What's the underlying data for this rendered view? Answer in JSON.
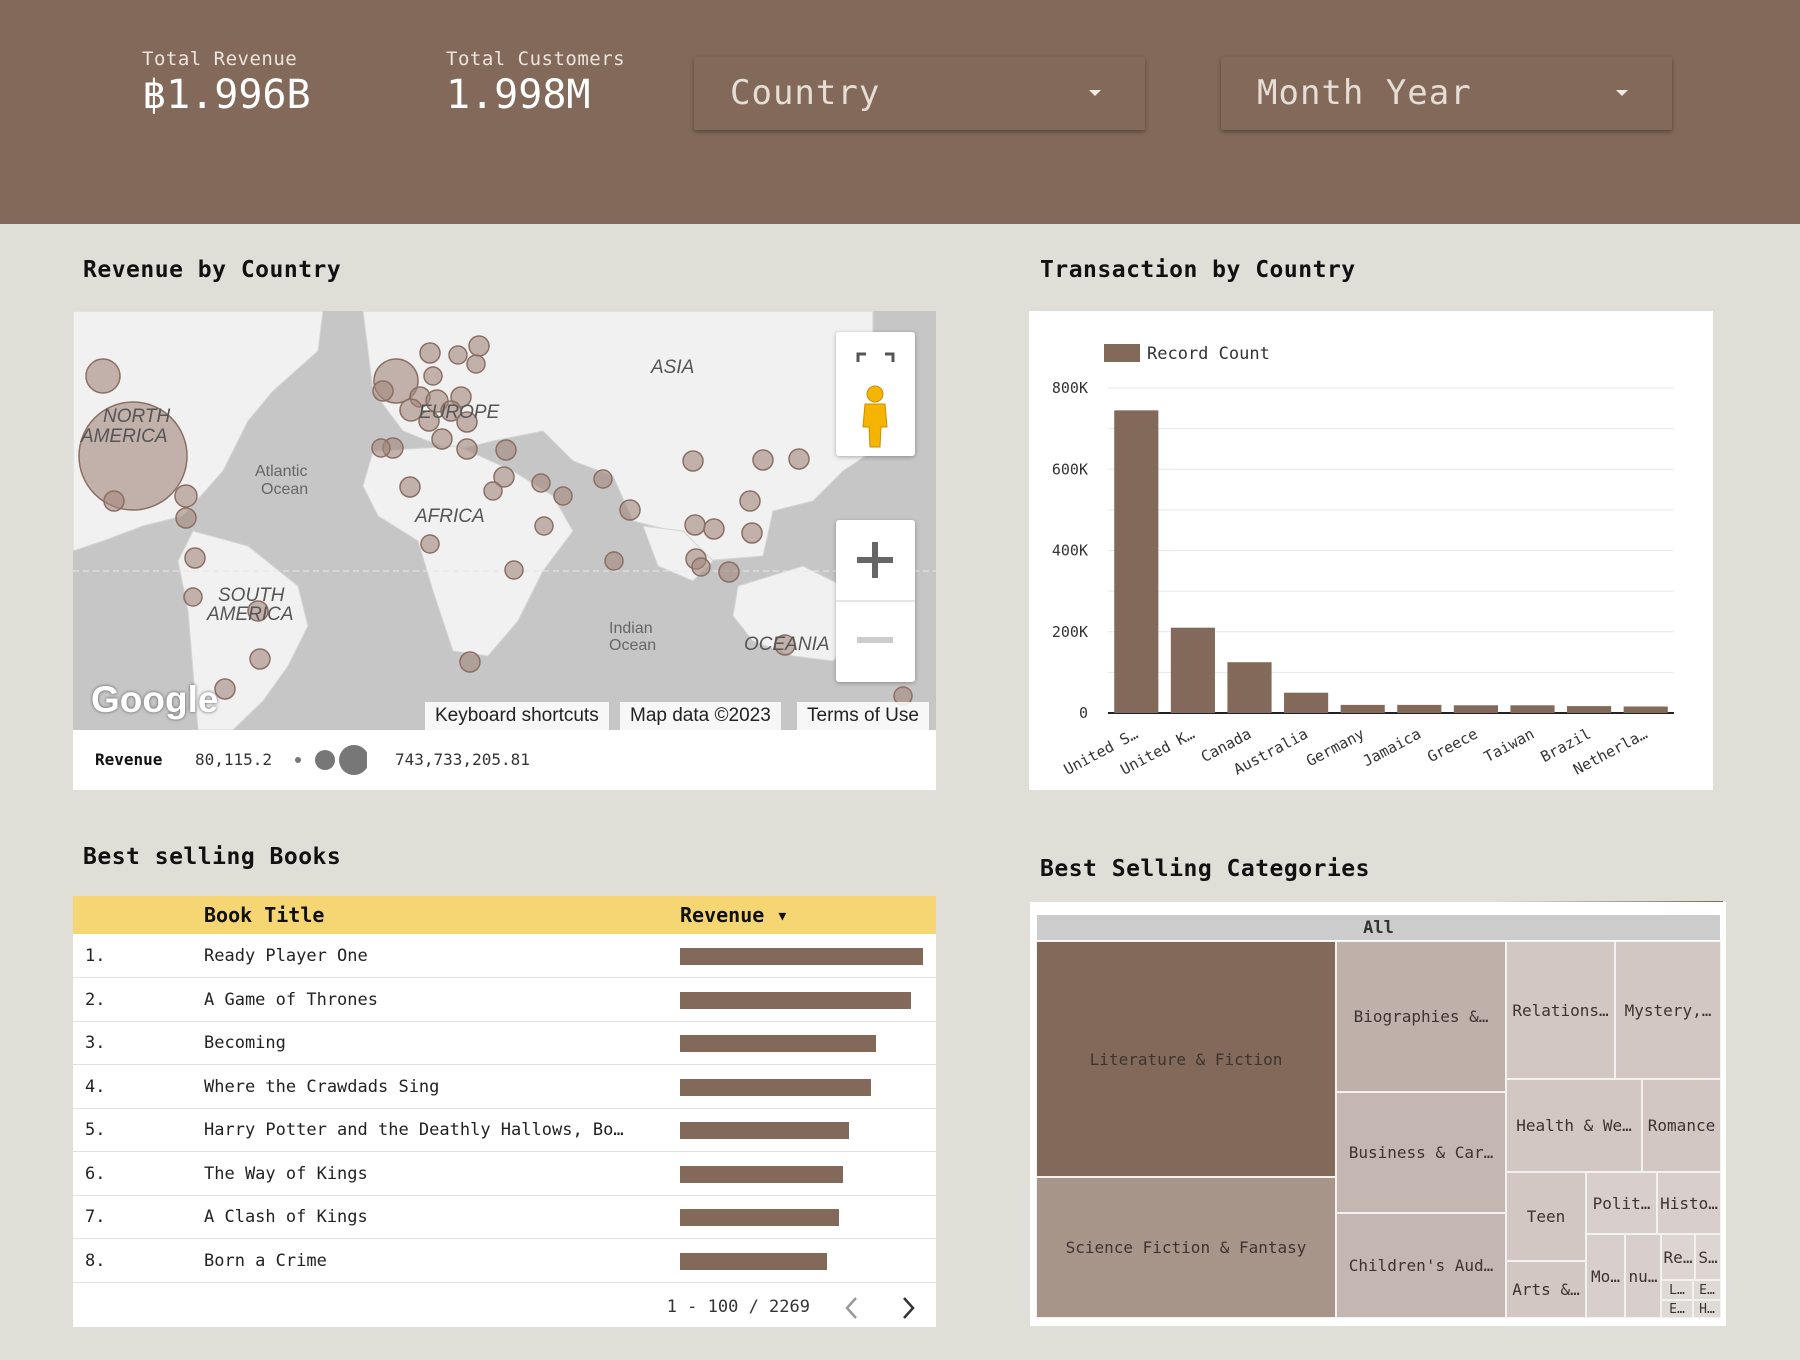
{
  "header": {
    "kpis": [
      {
        "label": "Total Revenue",
        "value": "฿1.996B"
      },
      {
        "label": "Total Customers",
        "value": "1.998M"
      }
    ],
    "filters": [
      {
        "label": "Country"
      },
      {
        "label": "Month Year"
      }
    ]
  },
  "revenue_map": {
    "title": "Revenue by Country",
    "continents": [
      "NORTH AMERICA",
      "SOUTH AMERICA",
      "EUROPE",
      "AFRICA",
      "ASIA",
      "OCEANIA"
    ],
    "oceans": [
      "Atlantic Ocean",
      "Indian Ocean"
    ],
    "attribution": {
      "logo": "Google",
      "shortcuts": "Keyboard shortcuts",
      "map_data": "Map data ©2023",
      "terms": "Terms of Use"
    },
    "legend": {
      "metric": "Revenue",
      "min": "80,115.2",
      "max": "743,733,205.81"
    }
  },
  "transaction_chart": {
    "title": "Transaction by Country",
    "chart_data": {
      "type": "bar",
      "legend": "Record Count",
      "categories": [
        "United S…",
        "United K…",
        "Canada",
        "Australia",
        "Germany",
        "Jamaica",
        "Greece",
        "Taiwan",
        "Brazil",
        "Netherla…"
      ],
      "values": [
        745000,
        210000,
        125000,
        50000,
        20000,
        20000,
        19000,
        19000,
        17000,
        16000
      ],
      "yticks": [
        "0",
        "200K",
        "400K",
        "600K",
        "800K"
      ],
      "ylim": [
        0,
        800000
      ],
      "color": "#836959"
    }
  },
  "books_table": {
    "title": "Best selling Books",
    "columns": {
      "title": "Book Title",
      "revenue": "Revenue ▾"
    },
    "rows": [
      {
        "n": "1.",
        "title": "Ready Player One",
        "revenue": 1.0
      },
      {
        "n": "2.",
        "title": "A Game of Thrones",
        "revenue": 0.95
      },
      {
        "n": "3.",
        "title": "Becoming",
        "revenue": 0.805
      },
      {
        "n": "4.",
        "title": "Where the Crawdads Sing",
        "revenue": 0.785
      },
      {
        "n": "5.",
        "title": "Harry Potter and the Deathly Hallows, Bo…",
        "revenue": 0.695
      },
      {
        "n": "6.",
        "title": "The Way of Kings",
        "revenue": 0.67
      },
      {
        "n": "7.",
        "title": "A Clash of Kings",
        "revenue": 0.655
      },
      {
        "n": "8.",
        "title": "Born a Crime",
        "revenue": 0.605
      }
    ],
    "pager": "1 - 100 / 2269"
  },
  "categories_treemap": {
    "title": "Best Selling Categories",
    "root": "All",
    "cells": [
      {
        "label": "Literature & Fiction",
        "color": "#836959"
      },
      {
        "label": "Science Fiction & Fantasy",
        "color": "#a8958a"
      },
      {
        "label": "Biographies &…",
        "color": "#bfb1aa"
      },
      {
        "label": "Business & Car…",
        "color": "#c4b7b1"
      },
      {
        "label": "Children's Aud…",
        "color": "#c4b7b1"
      },
      {
        "label": "Relations…",
        "color": "#d2c7c3"
      },
      {
        "label": "Mystery,…",
        "color": "#d2c7c3"
      },
      {
        "label": "Health & We…",
        "color": "#d2c7c3"
      },
      {
        "label": "Romance",
        "color": "#d2c7c3"
      },
      {
        "label": "Teen",
        "color": "#d2c7c3"
      },
      {
        "label": "Arts &…",
        "color": "#d2c7c3"
      },
      {
        "label": "Polit…",
        "color": "#d8cfcc"
      },
      {
        "label": "Histo…",
        "color": "#d8cfcc"
      },
      {
        "label": "Mo…",
        "color": "#d8cfcc"
      },
      {
        "label": "nu…",
        "color": "#d8cfcc"
      },
      {
        "label": "Re…",
        "color": "#dcd5d2"
      },
      {
        "label": "S…",
        "color": "#dcd5d2"
      },
      {
        "label": "L…",
        "color": "#e0dad7"
      },
      {
        "label": "E…",
        "color": "#e0dad7"
      },
      {
        "label": "E…",
        "color": "#e0dad7"
      },
      {
        "label": "H…",
        "color": "#e0dad7"
      }
    ]
  }
}
